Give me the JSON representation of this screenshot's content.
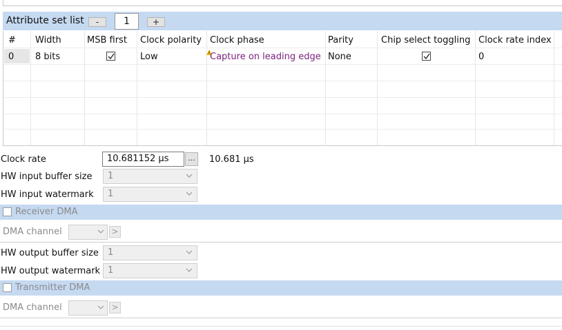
{
  "attribute_set": {
    "title": "Attribute set list",
    "minus_label": "-",
    "plus_label": "+",
    "index_value": "1"
  },
  "table": {
    "headers": [
      "#",
      "Width",
      "MSB first",
      "Clock polarity",
      "Clock phase",
      "Parity",
      "Chip select toggling",
      "Clock rate index"
    ],
    "rows": [
      {
        "num": "0",
        "width": "8 bits",
        "msb_first": true,
        "clock_polarity": "Low",
        "clock_phase": "Capture on leading edge",
        "parity": "None",
        "chip_select_toggling": true,
        "clock_rate_index": "0"
      }
    ]
  },
  "clock_rate": {
    "label": "Clock rate",
    "value": "10.681152 µs",
    "browse_label": "...",
    "computed": "10.681 µs"
  },
  "hw_input_buffer_size": {
    "label": "HW input buffer size",
    "value": "1"
  },
  "hw_input_watermark": {
    "label": "HW input watermark",
    "value": "1"
  },
  "receiver_dma": {
    "label": "Receiver DMA",
    "checked": false,
    "dma_channel_label": "DMA channel",
    "arrow_label": ">"
  },
  "hw_output_buffer_size": {
    "label": "HW output buffer size",
    "value": "1"
  },
  "hw_output_watermark": {
    "label": "HW output watermark",
    "value": "1"
  },
  "transmitter_dma": {
    "label": "Transmitter DMA",
    "checked": false,
    "dma_channel_label": "DMA channel",
    "arrow_label": ">"
  },
  "colors": {
    "section_header": "#c5d9f1",
    "clock_phase_text": "#7a1e7a",
    "warning_icon": "#e8b400"
  }
}
